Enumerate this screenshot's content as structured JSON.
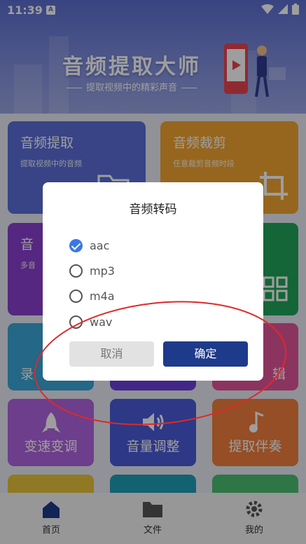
{
  "status_bar": {
    "time": "11:39",
    "app_badge": "A",
    "icons": [
      "wifi-icon",
      "signal-icon",
      "battery-icon"
    ]
  },
  "banner": {
    "title": "音频提取大师",
    "subtitle": "提取视频中的精彩声音"
  },
  "tiles": {
    "audio_extract": {
      "title": "音频提取",
      "sub": "提取视频中的音频",
      "color": "#5b6fd8"
    },
    "audio_cut": {
      "title": "音频裁剪",
      "sub": "任意裁剪音频时段",
      "color": "#f2a531"
    },
    "row2_left": {
      "title": "音",
      "sub": "多音",
      "color": "#8a3fd1"
    },
    "row2_right": {
      "color": "#21a35a"
    },
    "row3_left": {
      "title": "录",
      "color": "#3aa7d8"
    },
    "row3_mid": {
      "color": "#6b3fd8"
    },
    "row3_right": {
      "title": "辑",
      "color": "#e0559a"
    },
    "speed": {
      "label": "变速变调",
      "color": "#b165e0"
    },
    "volume": {
      "label": "音量调整",
      "color": "#4a5bd8"
    },
    "accompaniment": {
      "label": "提取伴奏",
      "color": "#f07f3c"
    },
    "row5": [
      "#e8c33a",
      "#1f9fb8",
      "#4bbf72"
    ]
  },
  "dialog": {
    "title": "音频转码",
    "options": [
      {
        "label": "aac",
        "checked": true
      },
      {
        "label": "mp3",
        "checked": false
      },
      {
        "label": "m4a",
        "checked": false
      },
      {
        "label": "wav",
        "checked": false
      }
    ],
    "cancel_label": "取消",
    "ok_label": "确定"
  },
  "bottom_nav": {
    "home": "首页",
    "files": "文件",
    "mine": "我的"
  },
  "colors": {
    "accent": "#1e3a8a",
    "annotation": "#e0282a"
  }
}
